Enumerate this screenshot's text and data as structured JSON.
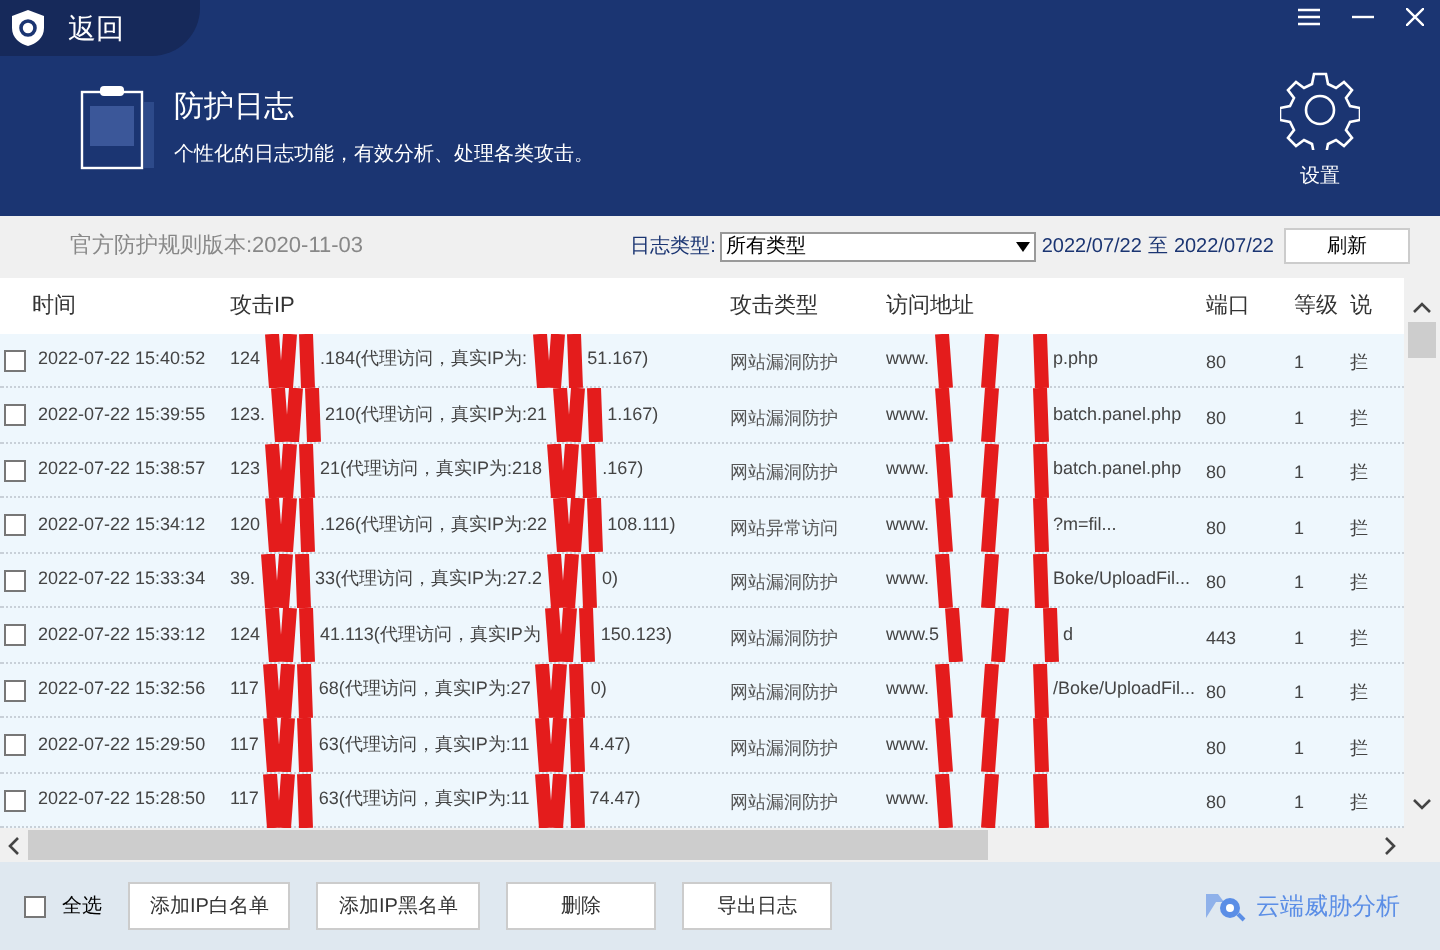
{
  "window": {
    "back_label": "返回"
  },
  "header": {
    "title": "防护日志",
    "subtitle": "个性化的日志功能，有效分析、处理各类攻击。",
    "settings_label": "设置"
  },
  "toolbar": {
    "rule_version": "官方防护规则版本:2020-11-03",
    "log_type_label": "日志类型:",
    "log_type_value": "所有类型",
    "date_from": "2022/07/22",
    "date_sep": "至",
    "date_to": "2022/07/22",
    "refresh_button": "刷新"
  },
  "table": {
    "columns": [
      "时间",
      "攻击IP",
      "攻击类型",
      "访问地址",
      "端口",
      "等级",
      "说"
    ],
    "rows": [
      {
        "checked": false,
        "time": "2022-07-22 15:40:52",
        "ip": [
          "124",
          ".184(代理访问，真实IP为:",
          "51.167)"
        ],
        "type": "网站漏洞防护",
        "url": [
          "www.",
          "p.php"
        ],
        "port": "80",
        "level_text": "1",
        "column_7": "拦"
      },
      {
        "checked": false,
        "time": "2022-07-22 15:39:55",
        "ip": [
          "123.",
          "210(代理访问，真实IP为:21",
          "1.167)"
        ],
        "type": "网站漏洞防护",
        "url": [
          "www.",
          "batch.panel.php"
        ],
        "port": "80",
        "level_text": "1",
        "column_7": "拦"
      },
      {
        "checked": false,
        "time": "2022-07-22 15:38:57",
        "ip": [
          "123",
          "21(代理访问，真实IP为:218",
          ".167)"
        ],
        "type": "网站漏洞防护",
        "url": [
          "www.",
          "batch.panel.php"
        ],
        "port": "80",
        "level_text": "1",
        "column_7": "拦"
      },
      {
        "checked": false,
        "time": "2022-07-22 15:34:12",
        "ip": [
          "120",
          ".126(代理访问，真实IP为:22",
          "108.111)"
        ],
        "type": "网站异常访问",
        "url": [
          "www.",
          "?m=fil..."
        ],
        "port": "80",
        "level_text": "1",
        "column_7": "拦"
      },
      {
        "checked": false,
        "time": "2022-07-22 15:33:34",
        "ip": [
          "39.",
          "33(代理访问，真实IP为:27.2",
          "0)"
        ],
        "type": "网站漏洞防护",
        "url": [
          "www.",
          "Boke/UploadFil..."
        ],
        "port": "80",
        "level_text": "1",
        "column_7": "拦"
      },
      {
        "checked": false,
        "time": "2022-07-22 15:33:12",
        "ip": [
          "124",
          "41.113(代理访问，真实IP为",
          "150.123)"
        ],
        "type": "网站漏洞防护",
        "url": [
          "www.5",
          "d"
        ],
        "port": "443",
        "level_text": "1",
        "column_7": "拦"
      },
      {
        "checked": false,
        "time": "2022-07-22 15:32:56",
        "ip": [
          "117",
          "68(代理访问，真实IP为:27",
          "0)"
        ],
        "type": "网站漏洞防护",
        "url": [
          "www.",
          "/Boke/UploadFil..."
        ],
        "port": "80",
        "level_text": "1",
        "column_7": "拦"
      },
      {
        "checked": false,
        "time": "2022-07-22 15:29:50",
        "ip": [
          "117",
          "63(代理访问，真实IP为:11",
          "4.47)"
        ],
        "type": "网站漏洞防护",
        "url": [
          "www."
        ],
        "port": "80",
        "level_text": "1",
        "column_7": "拦"
      },
      {
        "checked": false,
        "time": "2022-07-22 15:28:50",
        "ip": [
          "117",
          "63(代理访问，真实IP为:11",
          "74.47)"
        ],
        "type": "网站漏洞防护",
        "url": [
          "www."
        ],
        "port": "80",
        "level_text": "1",
        "column_7": "拦"
      }
    ]
  },
  "footer": {
    "select_all": {
      "label": "全选",
      "checked": false
    },
    "buttons": [
      "添加IP白名单",
      "添加IP黑名单",
      "删除",
      "导出日志"
    ],
    "brand": "云端威胁分析"
  }
}
